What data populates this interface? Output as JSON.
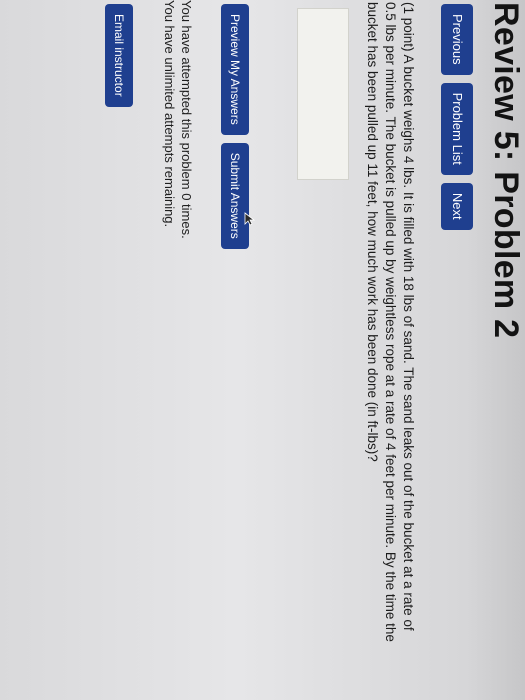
{
  "page": {
    "title": "Review 5: Problem 2"
  },
  "nav": {
    "previous_label": "Previous",
    "problem_list_label": "Problem List",
    "next_label": "Next"
  },
  "problem": {
    "text": "(1 point) A bucket weighs 4 lbs. It is filled with 18 lbs of sand. The sand leaks out of the bucket at a rate of 0.5 lbs per minute. The bucket is pulled up by weightless rope at a rate of 4 feet per minute. By the time the bucket has been pulled up 11 feet, how much work has been done (in ft-lbs)?",
    "answer_value": ""
  },
  "actions": {
    "preview_label": "Preview My Answers",
    "submit_label": "Submit Answers"
  },
  "status": {
    "attempted": "You have attempted this problem 0 times.",
    "remaining": "You have unlimited attempts remaining."
  },
  "footer": {
    "email_label": "Email instructor"
  },
  "colors": {
    "button_bg": "#1f3f8f",
    "button_text": "#ffffff",
    "answer_box_bg": "#f2f2ee"
  }
}
